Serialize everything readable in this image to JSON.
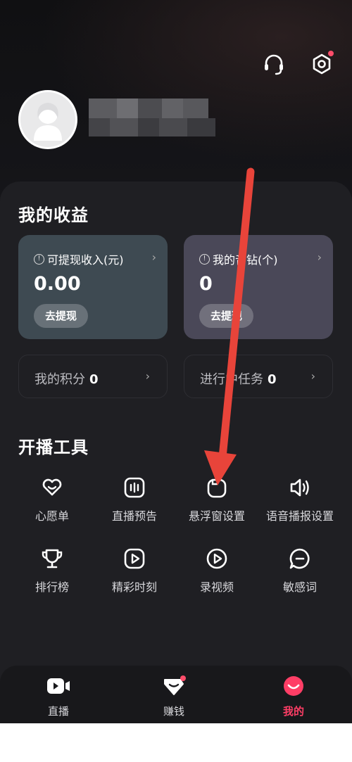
{
  "header": {
    "icons": [
      "headset-icon",
      "settings-icon"
    ]
  },
  "earnings": {
    "title": "我的收益",
    "withdrawable": {
      "label": "可提现收入(元)",
      "value": "0.00",
      "button": "去提现"
    },
    "diamonds": {
      "label": "我的音钻(个)",
      "value": "0",
      "button": "去提现"
    },
    "points": {
      "label": "我的积分",
      "value": "0"
    },
    "tasks": {
      "label": "进行中任务",
      "value": "0"
    }
  },
  "tools": {
    "title": "开播工具",
    "items": [
      {
        "label": "心愿单",
        "icon": "heart-icon"
      },
      {
        "label": "直播预告",
        "icon": "preview-icon"
      },
      {
        "label": "悬浮窗设置",
        "icon": "floating-window-icon"
      },
      {
        "label": "语音播报设置",
        "icon": "speaker-icon"
      },
      {
        "label": "排行榜",
        "icon": "trophy-icon"
      },
      {
        "label": "精彩时刻",
        "icon": "highlight-icon"
      },
      {
        "label": "录视频",
        "icon": "record-video-icon"
      },
      {
        "label": "敏感词",
        "icon": "chat-icon"
      }
    ]
  },
  "tabbar": {
    "items": [
      {
        "label": "直播",
        "icon": "live-icon"
      },
      {
        "label": "赚钱",
        "icon": "earn-icon"
      },
      {
        "label": "我的",
        "icon": "me-icon"
      }
    ],
    "active_color": "#ff3e66"
  },
  "colors": {
    "card_left": "#3e4a52",
    "card_right": "#4a4858",
    "arrow": "#e8443a"
  }
}
